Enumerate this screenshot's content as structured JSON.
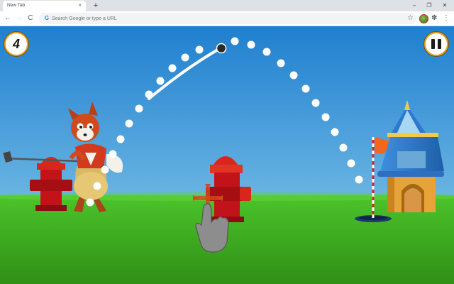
{
  "browser": {
    "tab_title": "New Tab",
    "tab_close": "×",
    "new_tab": "+",
    "window_controls": {
      "minimize": "–",
      "maximize": "❐",
      "close": "✕"
    },
    "nav": {
      "back": "←",
      "forward": "→",
      "reload": "C"
    },
    "omnibox": {
      "placeholder": "Search Google or type a URL",
      "value": "",
      "google_glyph": "G"
    },
    "toolbar_icons": {
      "bookmark": "☆",
      "extensions": "✽",
      "menu": "⋮"
    }
  },
  "game": {
    "strokes": "4",
    "pause_icon": "pause-icon",
    "colors": {
      "sky_top": "#1f7fcf",
      "sky_bottom": "#8fd0ec",
      "grass_top": "#4cc42a",
      "grass_bottom": "#2f8f17",
      "hydrant": "#d0161a",
      "flag": "#f0671f",
      "hud_ring": "#e6a21c"
    }
  }
}
